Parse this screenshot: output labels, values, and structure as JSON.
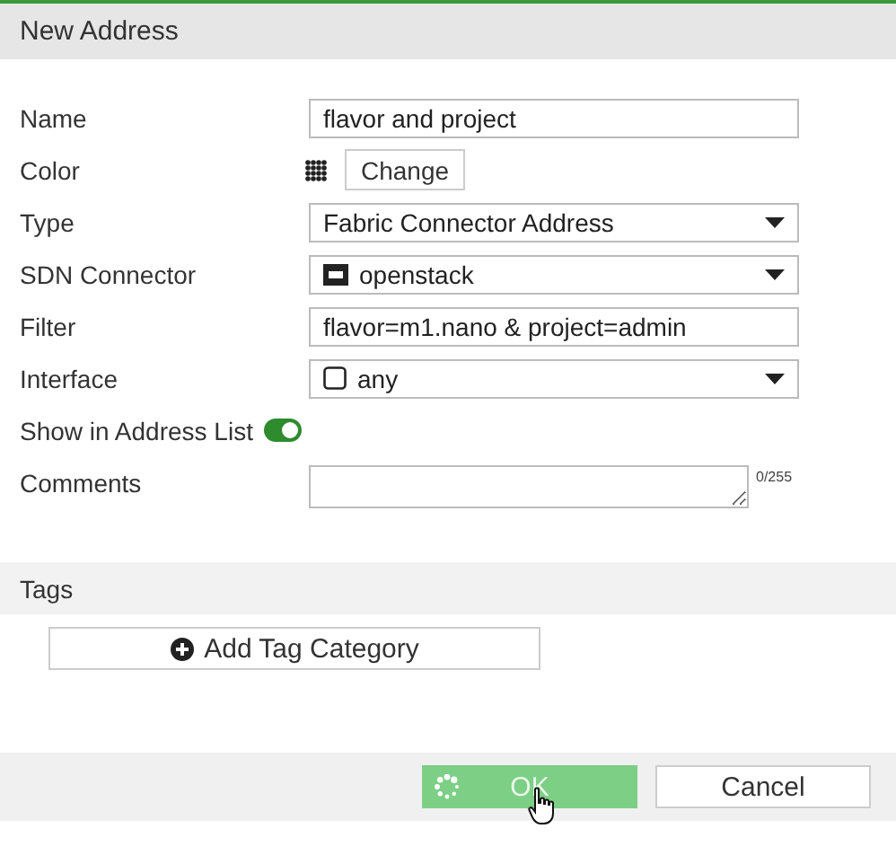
{
  "window": {
    "title": "New Address"
  },
  "fields": [
    {
      "label": "Name",
      "kind": "text",
      "value": "flavor and project"
    },
    {
      "label": "Color",
      "kind": "color",
      "button": "Change"
    },
    {
      "label": "Type",
      "kind": "select",
      "value": "Fabric Connector Address"
    },
    {
      "label": "SDN Connector",
      "kind": "connector",
      "value": "openstack"
    },
    {
      "label": "Filter",
      "kind": "text",
      "value": "flavor=m1.nano & project=admin"
    },
    {
      "label": "Interface",
      "kind": "interface",
      "value": "any"
    },
    {
      "label": "Show in Address List",
      "kind": "toggle",
      "on": true
    },
    {
      "label": "Comments",
      "kind": "comments",
      "counter": "0/255"
    }
  ],
  "tags": {
    "title": "Tags",
    "button": "Add Tag Category"
  },
  "buttons": [
    {
      "label": "OK",
      "kind": "primary",
      "busy": true
    },
    {
      "label": "Cancel",
      "kind": "secondary",
      "busy": false
    }
  ]
}
